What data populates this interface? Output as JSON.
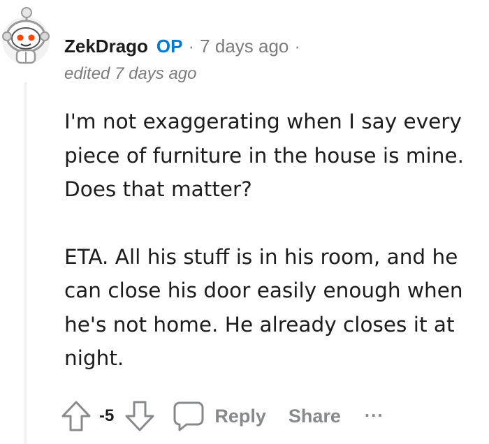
{
  "comment": {
    "author": "ZekDrago",
    "op_badge": "OP",
    "separator": "·",
    "timestamp": "7 days ago",
    "edited": "edited 7 days ago",
    "paragraphs": [
      "I'm not exaggerating when I say every piece of furniture in the house is mine. Does that matter?",
      "ETA. All his stuff is in his room, and he can close his door easily enough when he's not home. He already closes it at night."
    ]
  },
  "actions": {
    "vote_count": "-5",
    "reply_label": "Reply",
    "share_label": "Share",
    "more_label": "..."
  },
  "colors": {
    "op_blue": "#0079d3",
    "meta_gray": "#7c7c7c",
    "action_gray": "#878a8c",
    "text": "#1c1c1c",
    "avatar_orange": "#ff4500"
  },
  "icons": [
    "snoo-avatar-icon",
    "upvote-arrow-icon",
    "downvote-arrow-icon",
    "comment-bubble-icon",
    "more-dots-icon"
  ]
}
